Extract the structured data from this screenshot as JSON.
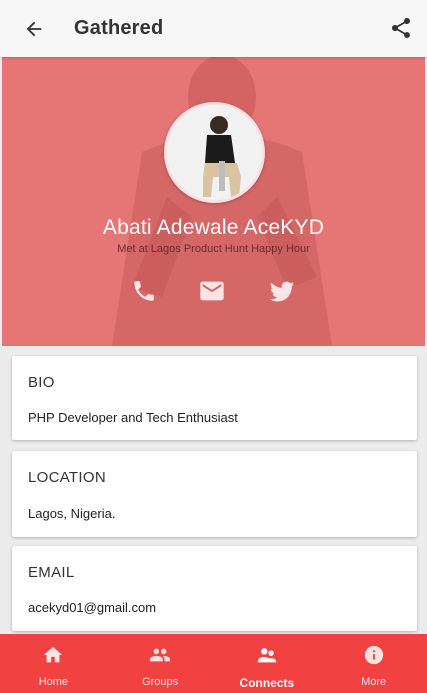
{
  "app": {
    "title": "Gathered"
  },
  "topbar": {
    "back_icon": "arrow-back-icon",
    "share_icon": "share-icon"
  },
  "profile": {
    "name": "Abati Adewale AceKYD",
    "met": "Met at Lagos Product Hunt Happy Hour",
    "actions": [
      {
        "icon": "phone-icon"
      },
      {
        "icon": "email-icon"
      },
      {
        "icon": "twitter-icon"
      }
    ]
  },
  "cards": [
    {
      "label": "BIO",
      "value": "PHP Developer and Tech Enthusiast"
    },
    {
      "label": "LOCATION",
      "value": "Lagos, Nigeria."
    },
    {
      "label": "EMAIL",
      "value": "acekyd01@gmail.com"
    }
  ],
  "bottom_nav": [
    {
      "label": "Home",
      "icon": "home-icon"
    },
    {
      "label": "Groups",
      "icon": "groups-icon"
    },
    {
      "label": "Connects",
      "icon": "connects-icon",
      "active": true
    },
    {
      "label": "More",
      "icon": "info-icon"
    }
  ],
  "colors": {
    "hero": "#e67676",
    "bottom_nav": "#f24141",
    "topbar": "#f7f7f7"
  }
}
